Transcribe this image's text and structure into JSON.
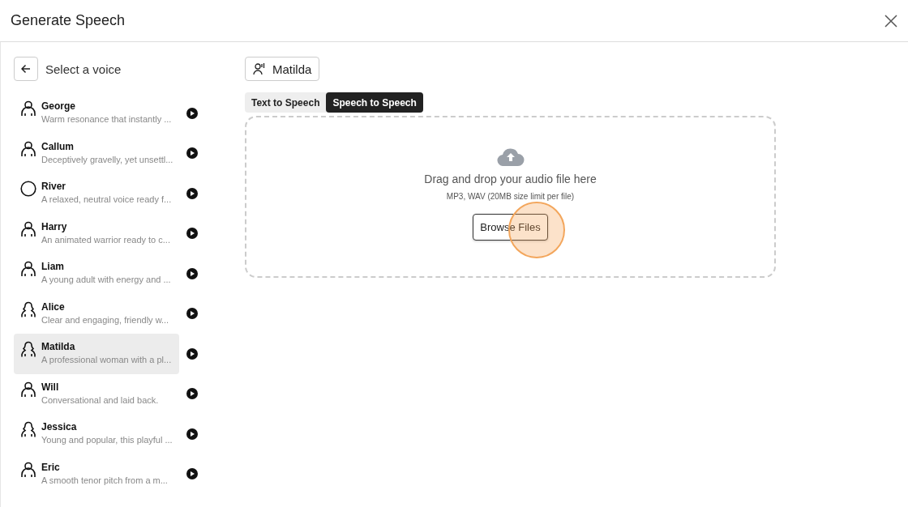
{
  "window": {
    "title": "Generate Speech"
  },
  "sidebar": {
    "title": "Select a voice",
    "voices": [
      {
        "name": "George",
        "description": "Warm resonance that instantly ...",
        "kind": "male",
        "selected": false
      },
      {
        "name": "Callum",
        "description": "Deceptively gravelly, yet unsettl...",
        "kind": "male",
        "selected": false
      },
      {
        "name": "River",
        "description": "A relaxed, neutral voice ready f...",
        "kind": "neutral",
        "selected": false
      },
      {
        "name": "Harry",
        "description": "An animated warrior ready to c...",
        "kind": "male",
        "selected": false
      },
      {
        "name": "Liam",
        "description": "A young adult with energy and ...",
        "kind": "male",
        "selected": false
      },
      {
        "name": "Alice",
        "description": "Clear and engaging, friendly w...",
        "kind": "female",
        "selected": false
      },
      {
        "name": "Matilda",
        "description": "A professional woman with a pl...",
        "kind": "female",
        "selected": true
      },
      {
        "name": "Will",
        "description": "Conversational and laid back.",
        "kind": "male",
        "selected": false
      },
      {
        "name": "Jessica",
        "description": "Young and popular, this playful ...",
        "kind": "female",
        "selected": false
      },
      {
        "name": "Eric",
        "description": "A smooth tenor pitch from a m...",
        "kind": "male",
        "selected": false
      }
    ]
  },
  "selected_voice": "Matilda",
  "tabs": [
    {
      "label": "Text to Speech",
      "selected": false
    },
    {
      "label": "Speech to Speech",
      "selected": true
    }
  ],
  "dropzone": {
    "title": "Drag and drop your audio file here",
    "hint": "MP3, WAV (20MB size limit per file)",
    "button": {
      "label": "Browse Files",
      "highlighted": true
    }
  }
}
